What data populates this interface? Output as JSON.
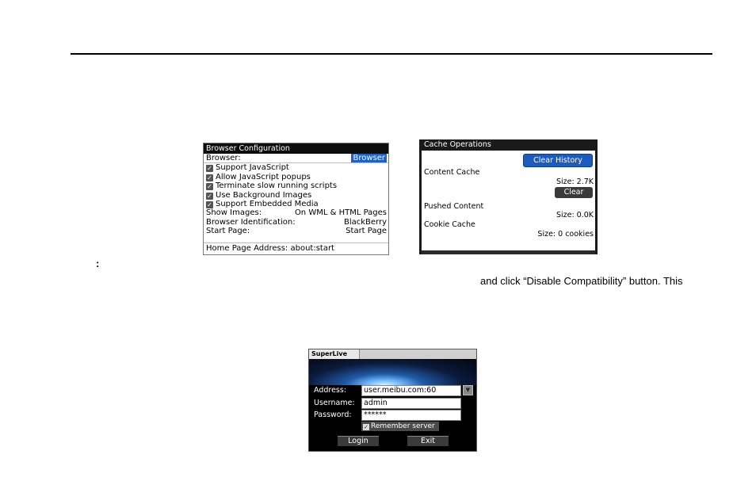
{
  "document": {
    "colon_marker": ":",
    "body_fragment": "and  click  “Disable  Compatibility”  button.  This"
  },
  "browser_config": {
    "title": "Browser Configuration",
    "browser_label": "Browser:",
    "browser_value": "Browser",
    "options": [
      {
        "label": "Support JavaScript",
        "checked": true
      },
      {
        "label": "Allow JavaScript popups",
        "checked": true
      },
      {
        "label": "Terminate slow running scripts",
        "checked": true
      },
      {
        "label": "Use Background Images",
        "checked": true
      },
      {
        "label": "Support Embedded Media",
        "checked": true
      }
    ],
    "show_images_label": "Show Images:",
    "show_images_value": "On WML & HTML Pages",
    "browser_id_label": "Browser Identification:",
    "browser_id_value": "BlackBerry",
    "start_page_label": "Start Page:",
    "start_page_value": "Start Page",
    "home_page": "Home Page Address: about:start"
  },
  "cache_ops": {
    "title": "Cache Operations",
    "clear_history_button": "Clear History",
    "content_cache_label": "Content Cache",
    "content_cache_size": "Size: 2.7K",
    "clear_button": "Clear",
    "pushed_content_label": "Pushed Content",
    "pushed_content_size": "Size: 0.0K",
    "cookie_cache_label": "Cookie Cache",
    "cookie_cache_size": "Size: 0 cookies"
  },
  "superlive": {
    "tab": "SuperLive",
    "address_label": "Address:",
    "address_value": "user.meibu.com:60",
    "username_label": "Username:",
    "username_value": "admin",
    "password_label": "Password:",
    "password_value": "******",
    "remember_label": "Remember server",
    "remember_checked": true,
    "login_button": "Login",
    "exit_button": "Exit"
  }
}
